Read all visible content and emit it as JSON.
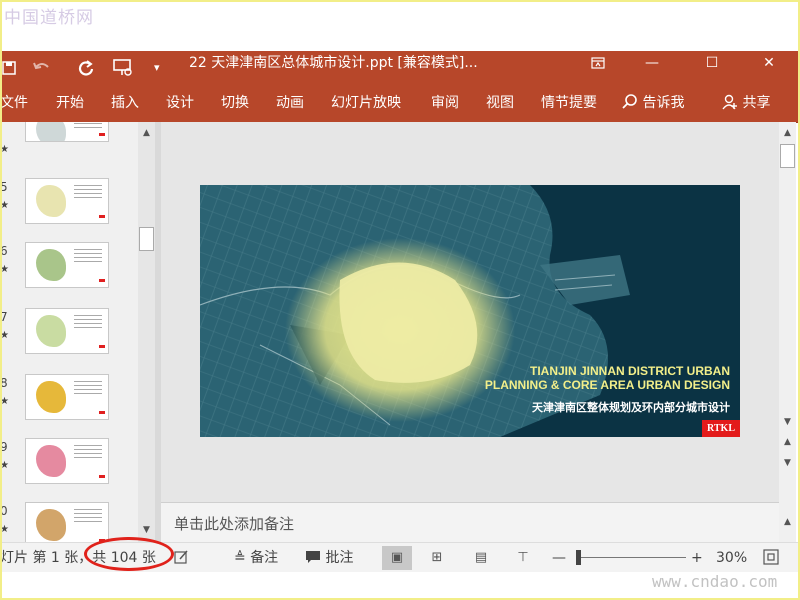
{
  "site_logo": "中国道桥网",
  "window": {
    "title": "22 天津津南区总体城市设计.ppt [兼容模式]...",
    "qat": {
      "undo_icon": "undo-icon",
      "redo_icon": "redo-icon",
      "more": "▾"
    },
    "controls": {
      "restore": "⧉",
      "minimize": "—",
      "maximize": "☐",
      "close": "✕"
    }
  },
  "ribbon": {
    "tabs": [
      "文件",
      "开始",
      "插入",
      "设计",
      "切换",
      "动画",
      "幻灯片放映",
      "审阅",
      "视图",
      "情节提要"
    ],
    "tell_me": "告诉我",
    "share": "共享"
  },
  "thumbnails": [
    {
      "num": "",
      "map_color": "#cfd8d8"
    },
    {
      "num": "5",
      "map_color": "#e8e4b0"
    },
    {
      "num": "6",
      "map_color": "#a9c58a"
    },
    {
      "num": "7",
      "map_color": "#c9dca2"
    },
    {
      "num": "8",
      "map_color": "#e6b83a"
    },
    {
      "num": "9",
      "map_color": "#e58aa0"
    },
    {
      "num": "0",
      "map_color": "#d2a56a"
    }
  ],
  "slide": {
    "title_en_line1": "TIANJIN JINNAN DISTRICT URBAN",
    "title_en_line2": "PLANNING & CORE AREA URBAN DESIGN",
    "title_cn": "天津津南区整体规划及环内部分城市设计",
    "logo": "RTKL"
  },
  "notes_placeholder": "单击此处添加备注",
  "status": {
    "slide_info": "灯片 第 1 张，共 104 张",
    "notes_btn": "备注",
    "comments_btn": "批注",
    "zoom_minus": "—",
    "zoom_plus": "+",
    "zoom": "30%"
  },
  "watermark": "www.cndao.com",
  "colors": {
    "ribbon": "#b7472a",
    "slide_bg": "#0d3d4f",
    "glow": "#f3ef8a",
    "annotation_red": "#e0221b"
  }
}
